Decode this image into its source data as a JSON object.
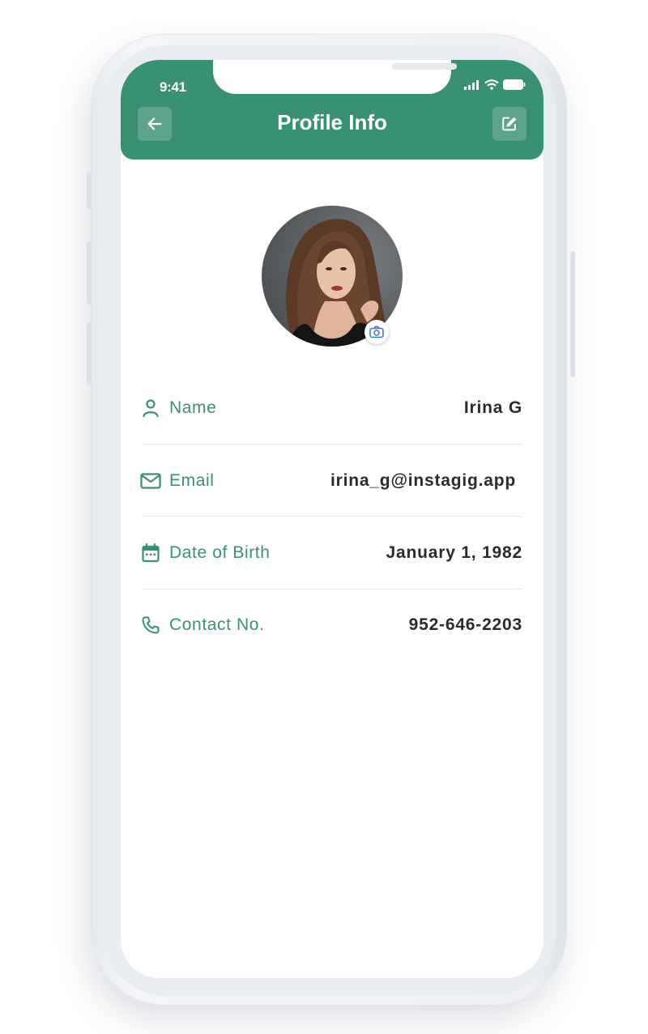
{
  "status_bar": {
    "time": "9:41"
  },
  "header": {
    "title": "Profile Info"
  },
  "profile": {
    "fields": [
      {
        "label": "Name",
        "value": "Irina G",
        "icon": "user-icon"
      },
      {
        "label": "Email",
        "value": "irina_g@instagig.app",
        "icon": "mail-icon"
      },
      {
        "label": "Date of Birth",
        "value": "January 1, 1982",
        "icon": "calendar-icon"
      },
      {
        "label": "Contact No.",
        "value": "952-646-2203",
        "icon": "phone-icon"
      }
    ]
  },
  "colors": {
    "accent": "#3a9172",
    "text": "#2b2b2b"
  }
}
